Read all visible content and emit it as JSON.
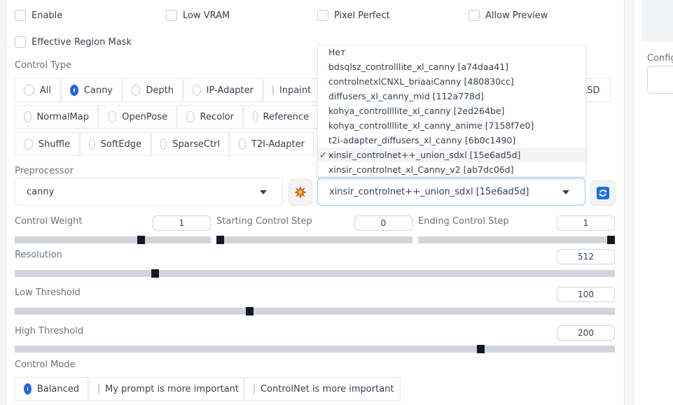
{
  "checkboxes": {
    "enable": "Enable",
    "low_vram": "Low VRAM",
    "pixel_perfect": "Pixel Perfect",
    "allow_preview": "Allow Preview",
    "effective_region_mask": "Effective Region Mask"
  },
  "control_type": {
    "label": "Control Type",
    "options": [
      "All",
      "Canny",
      "Depth",
      "IP-Adapter",
      "Inpaint",
      "LSD",
      "NormalMap",
      "OpenPose",
      "Recolor",
      "Reference",
      "Shuffle",
      "SoftEdge",
      "SparseCtrl",
      "T2I-Adapter"
    ],
    "selected": "Canny"
  },
  "preprocessor": {
    "label": "Preprocessor",
    "value": "canny"
  },
  "model": {
    "value": "xinsir_controlnet++_union_sdxl [15e6ad5d]",
    "options": [
      "Нет",
      "bdsqlsz_controlllite_xl_canny [a74daa41]",
      "controlnetxlCNXL_briaaiCanny [480830cc]",
      "diffusers_xl_canny_mid [112a778d]",
      "kohya_controllllite_xl_canny [2ed264be]",
      "kohya_controllllite_xl_canny_anime [7158f7e0]",
      "t2i-adapter_diffusers_xl_canny [6b0c1490]",
      "xinsir_controlnet++_union_sdxl [15e6ad5d]",
      "xinsir_controlnet_xl_Canny_v2 [ab7dc06d]"
    ],
    "check_mark": "✓"
  },
  "sliders": {
    "control_weight": {
      "label": "Control Weight",
      "value": "1",
      "level": 0.65
    },
    "starting_step": {
      "label": "Starting Control Step",
      "value": "0",
      "level": 0.0
    },
    "ending_step": {
      "label": "Ending Control Step",
      "value": "1",
      "level": 1.0
    },
    "resolution": {
      "label": "Resolution",
      "value": "512",
      "level": 0.23
    },
    "low_threshold": {
      "label": "Low Threshold",
      "value": "100",
      "level": 0.39
    },
    "high_threshold": {
      "label": "High Threshold",
      "value": "200",
      "level": 0.78
    }
  },
  "control_mode": {
    "label": "Control Mode",
    "options": [
      "Balanced",
      "My prompt is more important",
      "ControlNet is more important"
    ],
    "selected": "Balanced"
  },
  "side": {
    "config_label": "Config"
  },
  "icons": {
    "run": "explosion-icon",
    "refresh": "refresh-icon"
  },
  "colors": {
    "accent": "#2563eb",
    "thumb": "#111827",
    "track": "#d1d5db"
  }
}
